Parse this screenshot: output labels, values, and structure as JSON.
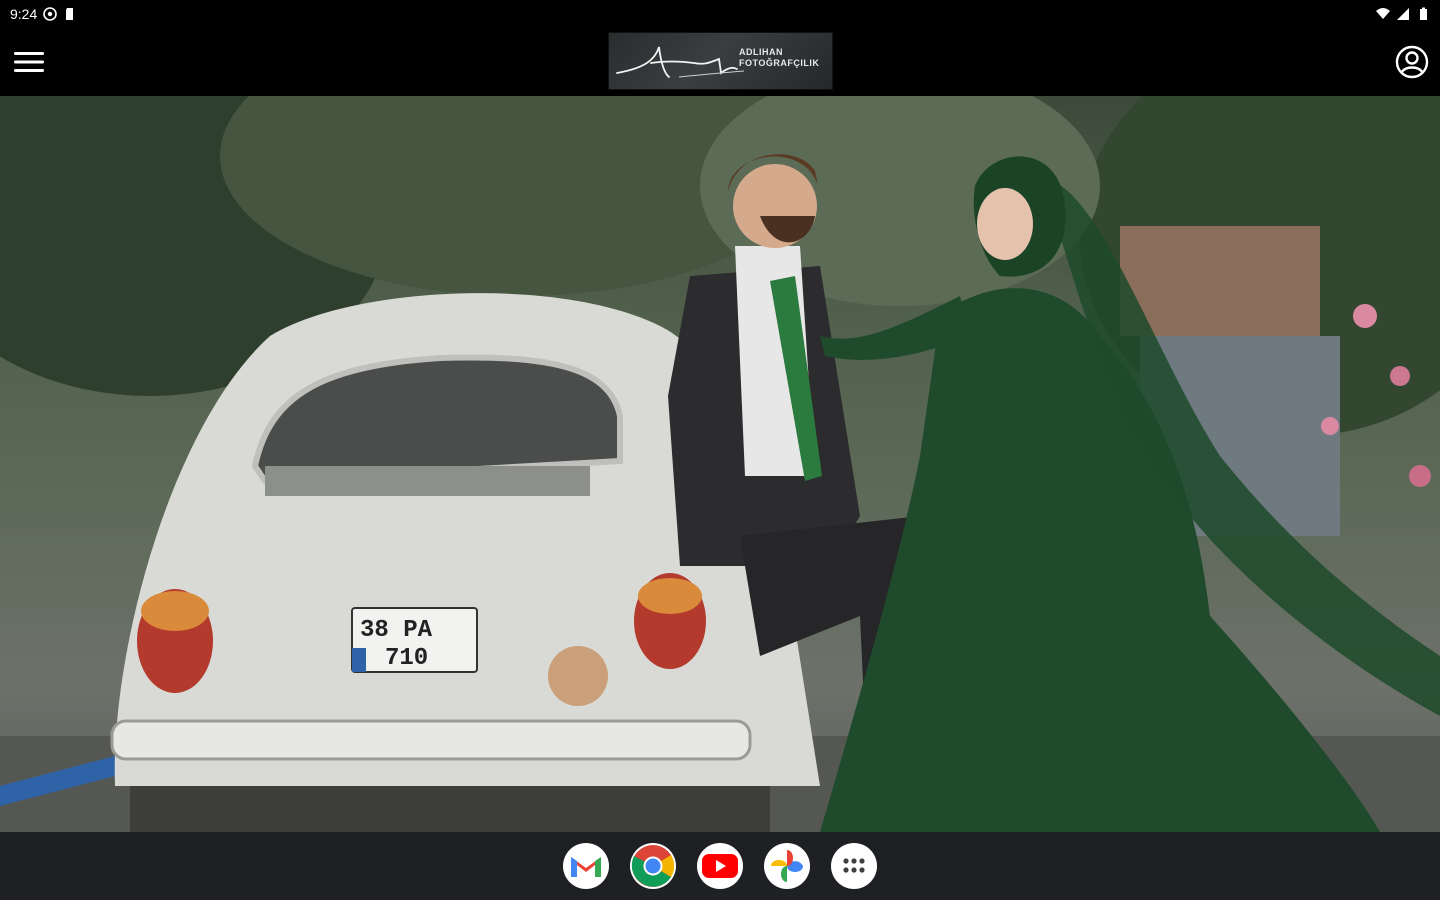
{
  "status": {
    "time": "9:24"
  },
  "header": {
    "logo_line1": "ADLIHAN",
    "logo_line2": "FOTOĞRAFÇILIK"
  },
  "hero": {
    "plate_line1": "38   PA",
    "plate_line2": "710"
  },
  "dock": {
    "apps": [
      "Gmail",
      "Chrome",
      "YouTube",
      "Photos",
      "App drawer"
    ]
  },
  "colors": {
    "statusbar": "#000000",
    "appbar": "#000000",
    "navbar": "#1f2023",
    "dress": "#1f4a2c"
  }
}
